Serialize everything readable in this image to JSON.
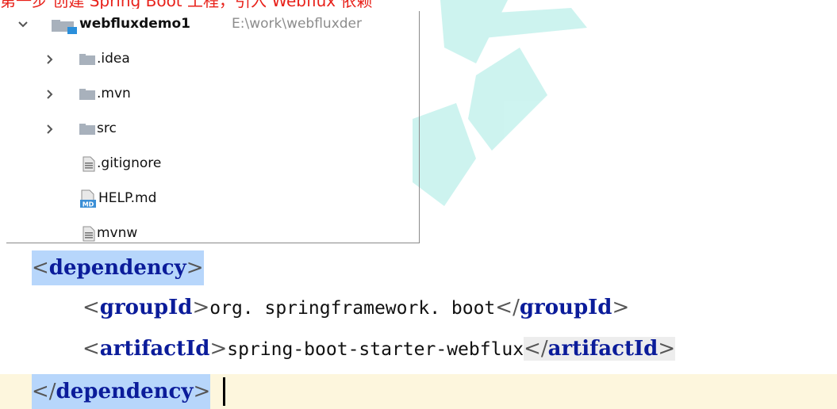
{
  "caption": "第一步 创建 Spring Boot 工程，引入 Webflux 依赖",
  "project_tree": {
    "root": {
      "name": "webfluxdemo1",
      "path": "E:\\work\\webfluxder"
    },
    "items": [
      {
        "name": ".idea",
        "icon": "folder-icon",
        "collapsible": true
      },
      {
        "name": ".mvn",
        "icon": "folder-icon",
        "collapsible": true
      },
      {
        "name": "src",
        "icon": "folder-icon",
        "collapsible": true
      },
      {
        "name": ".gitignore",
        "icon": "text-file-icon",
        "collapsible": false
      },
      {
        "name": "HELP.md",
        "icon": "markdown-file-icon",
        "collapsible": false
      },
      {
        "name": "mvnw",
        "icon": "text-file-icon",
        "collapsible": false
      }
    ]
  },
  "code": {
    "dependency_tag": "dependency",
    "group_tag": "groupId",
    "group_value": "org. springframework. boot",
    "artifact_tag": "artifactId",
    "artifact_value": "spring-boot-starter-webflux",
    "open_bracket": "<",
    "close_bracket": ">",
    "closing_prefix": "</"
  },
  "colors": {
    "caption": "#e8211a",
    "tag_name": "#0b1c9a",
    "selection_highlight": "#b7d6fb",
    "caret_line": "#fdf6dd",
    "watermark": "#4fd6c8"
  }
}
